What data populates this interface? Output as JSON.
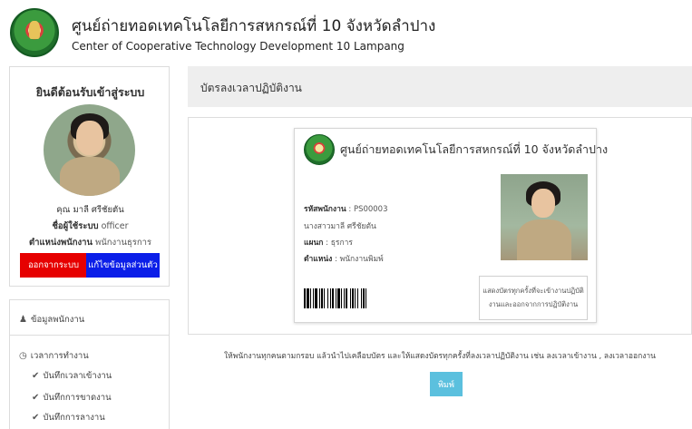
{
  "header": {
    "title_th": "ศูนย์ถ่ายทอดเทคโนโลยีการสหกรณ์ที่ 10 จังหวัดลำปาง",
    "title_en": "Center of Cooperative Technology Development 10 Lampang"
  },
  "welcome": {
    "title": "ยินดีต้อนรับเข้าสู่ระบบ",
    "name_prefix": "คุณ",
    "name": "มาลี ศรีชัยตัน",
    "username_label": "ชื่อผู้ใช้ระบบ",
    "username": "officer",
    "position_label": "ตำแหน่งพนักงาน",
    "position": "พนักงานธุรการ",
    "logout_label": "ออกจากระบบ",
    "edit_label": "แก้ไขข้อมูลส่วนตัว"
  },
  "menu": {
    "employee_info": "ข้อมูลพนักงาน",
    "work_time": "เวลาการทำงาน",
    "items": [
      "บันทึกเวลาเข้างาน",
      "บันทึกการขาดงาน",
      "บันทึกการลางาน"
    ]
  },
  "main": {
    "section_title": "บัตรลงเวลาปฏิบัติงาน",
    "instruction": "ให้พนักงานทุกคนตามกรอบ แล้วนำไปเคลือบบัตร และให้แสดงบัตรทุกครั้งที่ลงเวลาปฏิบัติงาน เช่น ลงเวลาเข้างาน , ลงเวลาออกงาน",
    "print_label": "พิมพ์"
  },
  "card": {
    "org": "ศูนย์ถ่ายทอดเทคโนโลยีการสหกรณ์ที่ 10 จังหวัดลำปาง",
    "id_label": "รหัสพนักงาน",
    "id_value": "PS00003",
    "full_name": "นางสาวมาลี ศรีชัยตัน",
    "dept_label": "แผนก",
    "dept_value": "ธุรการ",
    "position_label": "ตำแหน่ง",
    "position_value": "พนักงานพิมพ์",
    "note_line1": "แสดงบัตรทุกครั้งที่จะเข้างานปฏิบัติ",
    "note_line2": "งานและออกจากการปฏิบัติงาน"
  },
  "colors": {
    "logout": "#e60000",
    "edit": "#0b1ee8",
    "print": "#5bc0de",
    "section_bg": "#eeeeee"
  }
}
